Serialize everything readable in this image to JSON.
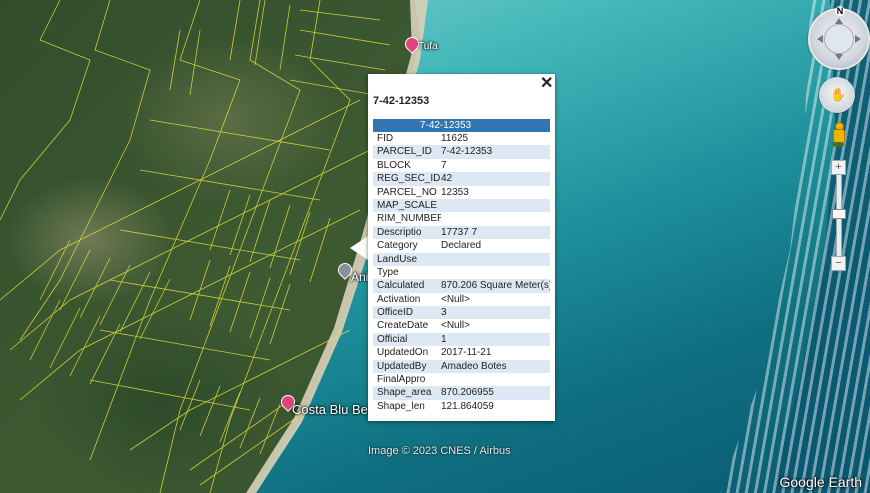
{
  "map": {
    "pins": [
      {
        "label": "Tufa",
        "color": "#e0447a"
      },
      {
        "label": "Anil",
        "color": "#8a8f98"
      },
      {
        "label": "Costa Blu Beach",
        "color": "#e0447a"
      }
    ],
    "copyright": "Image © 2023 CNES / Airbus",
    "brand": "Google Earth"
  },
  "popup": {
    "title": "7-42-12353",
    "close": "✕",
    "header": "7-42-12353",
    "rows": [
      {
        "key": "FID",
        "value": "11625"
      },
      {
        "key": "PARCEL_ID",
        "value": "7-42-12353"
      },
      {
        "key": "BLOCK",
        "value": "7"
      },
      {
        "key": "REG_SEC_ID",
        "value": "42"
      },
      {
        "key": "PARCEL_NO",
        "value": "12353"
      },
      {
        "key": "MAP_SCALE",
        "value": ""
      },
      {
        "key": "RIM_NUMBER",
        "value": ""
      },
      {
        "key": "Descriptio",
        "value": "17737 7"
      },
      {
        "key": "Category",
        "value": "Declared"
      },
      {
        "key": "LandUse",
        "value": ""
      },
      {
        "key": "Type",
        "value": ""
      },
      {
        "key": "Calculated",
        "value": "870.206 Square Meter(s)"
      },
      {
        "key": "Activation",
        "value": "<Null>"
      },
      {
        "key": "OfficeID",
        "value": "3"
      },
      {
        "key": "CreateDate",
        "value": "<Null>"
      },
      {
        "key": "Official",
        "value": "1"
      },
      {
        "key": "UpdatedOn",
        "value": "2017-11-21"
      },
      {
        "key": "UpdatedBy",
        "value": "Amadeo Botes"
      },
      {
        "key": "FinalAppro",
        "value": ""
      },
      {
        "key": "Shape_area",
        "value": "870.206955"
      },
      {
        "key": "Shape_len",
        "value": "121.864059"
      }
    ]
  },
  "nav": {
    "compass_north": "N",
    "zoom_plus": "+",
    "zoom_minus": "−",
    "pan_icon": "hand-icon"
  },
  "colors": {
    "parcel_lines": "#e8e23a",
    "table_header": "#3276b1",
    "row_alt": "#dde8f5"
  }
}
